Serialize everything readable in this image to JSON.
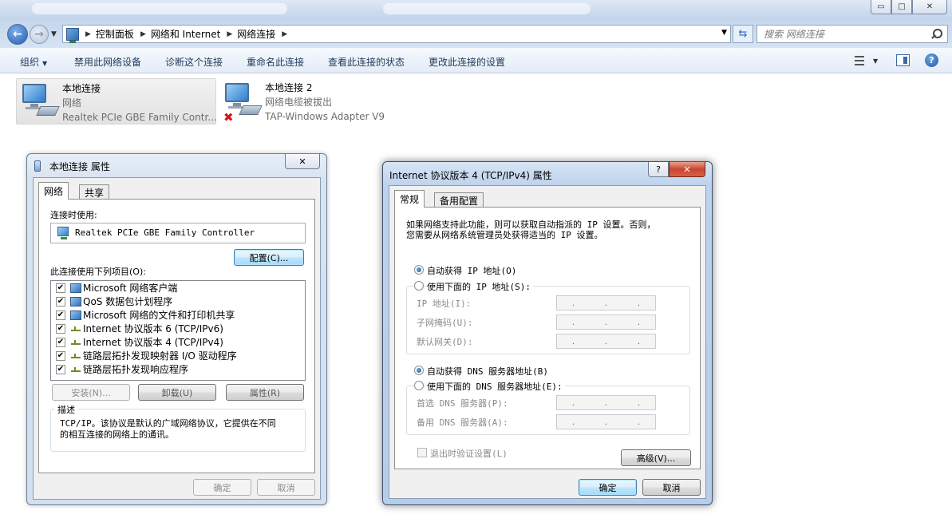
{
  "explorer": {
    "window_buttons": {
      "minimize": "▭",
      "maximize": "□",
      "close": "✕"
    },
    "breadcrumb": [
      "控制面板",
      "网络和 Internet",
      "网络连接"
    ],
    "search_placeholder": "搜索 网络连接",
    "commands": [
      "组织",
      "禁用此网络设备",
      "诊断这个连接",
      "重命名此连接",
      "查看此连接的状态",
      "更改此连接的设置"
    ],
    "help_label": "?"
  },
  "connections": [
    {
      "name": "本地连接",
      "status": "网络",
      "adapter": "Realtek PCIe GBE Family Contr..."
    },
    {
      "name": "本地连接 2",
      "status": "网络电缆被拔出",
      "adapter": "TAP-Windows Adapter V9"
    }
  ],
  "props_dialog": {
    "title": "本地连接 属性",
    "close_label": "✕",
    "tabs": [
      "网络",
      "共享"
    ],
    "connect_using_label": "连接时使用:",
    "device": "Realtek PCIe GBE Family Controller",
    "configure_button": "配置(C)...",
    "items_label": "此连接使用下列项目(O):",
    "items": [
      {
        "label": "Microsoft 网络客户端",
        "icon": "pc",
        "checked": true
      },
      {
        "label": "QoS 数据包计划程序",
        "icon": "pc",
        "checked": true
      },
      {
        "label": "Microsoft 网络的文件和打印机共享",
        "icon": "pc",
        "checked": true
      },
      {
        "label": "Internet 协议版本 6 (TCP/IPv6)",
        "icon": "proto",
        "checked": true
      },
      {
        "label": "Internet 协议版本 4 (TCP/IPv4)",
        "icon": "proto",
        "checked": true
      },
      {
        "label": "链路层拓扑发现映射器 I/O 驱动程序",
        "icon": "proto",
        "checked": true
      },
      {
        "label": "链路层拓扑发现响应程序",
        "icon": "proto",
        "checked": true
      }
    ],
    "check_mark": "✔",
    "install_button": "安装(N)...",
    "uninstall_button": "卸载(U)",
    "properties_button": "属性(R)",
    "description_legend": "描述",
    "description_line1": "TCP/IP。该协议是默认的广域网络协议，它提供在不同",
    "description_line2": "的相互连接的网络上的通讯。",
    "ok_button": "确定",
    "cancel_button": "取消"
  },
  "ipv4_dialog": {
    "title": "Internet 协议版本 4 (TCP/IPv4) 属性",
    "help_label": "?",
    "close_label": "✕",
    "tabs": [
      "常规",
      "备用配置"
    ],
    "intro_line1": "如果网络支持此功能，则可以获取自动指派的 IP 设置。否则，",
    "intro_line2": "您需要从网络系统管理员处获得适当的 IP 设置。",
    "auto_ip_label": "自动获得 IP 地址(O)",
    "manual_ip_label": "使用下面的 IP 地址(S):",
    "ip_address_label": "IP 地址(I):",
    "subnet_mask_label": "子网掩码(U):",
    "gateway_label": "默认网关(D):",
    "auto_dns_label": "自动获得 DNS 服务器地址(B)",
    "manual_dns_label": "使用下面的 DNS 服务器地址(E):",
    "preferred_dns_label": "首选 DNS 服务器(P):",
    "alternate_dns_label": "备用 DNS 服务器(A):",
    "ip_dot": ".",
    "validate_label": "退出时验证设置(L)",
    "advanced_button": "高级(V)...",
    "ok_button": "确定",
    "cancel_button": "取消",
    "selected": {
      "ip_mode": "auto",
      "dns_mode": "auto",
      "validate_on_exit": false
    }
  }
}
